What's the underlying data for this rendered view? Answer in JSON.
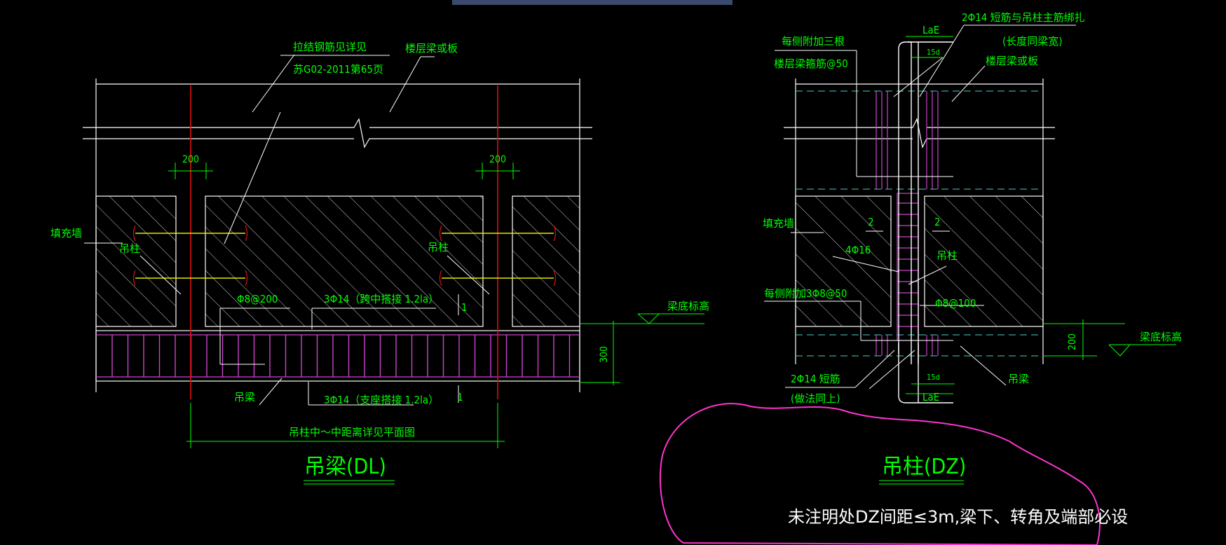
{
  "topbar": {
    "color": "#3a4a6e"
  },
  "colors": {
    "green": "#00ff00",
    "white": "#ffffff",
    "red": "#e01010",
    "magenta": "#cc44cc",
    "yellow": "#e8e800",
    "cyan": "#44cccc",
    "pink": "#ff33cc"
  },
  "left": {
    "note_ref_1": "拉结钢筋见详见",
    "note_ref_2": "苏G02-2011第65页",
    "slab_label": "楼层梁或板",
    "dim_200_a": "200",
    "dim_200_b": "200",
    "infill_label": "填充墙",
    "col_label_a": "吊柱",
    "col_label_b": "吊柱",
    "stirrup_label": "Φ8@200",
    "top_bar_label": "3Φ14（跨中搭接 1.2la）",
    "bot_bar_label": "3Φ14（支座搭接 1.2la）",
    "section_mark_1": "1",
    "section_mark_2": "1",
    "beam_bottom_label": "梁底标高",
    "dim_300": "300",
    "beam_label": "吊梁",
    "span_label": "吊柱中～中距离详见平面图",
    "title": "吊梁(DL)"
  },
  "right": {
    "lae_top": "LaE",
    "d15_top": "15d",
    "note_each_side_1": "每侧附加三根",
    "note_each_side_2": "楼层梁箍筋@50",
    "note_short_bar_1": "2Φ14 短筋与吊柱主筋绑扎",
    "note_short_bar_2": "(长度同梁宽)",
    "slab_label": "楼层梁或板",
    "infill_label": "填充墙",
    "num_2a": "2",
    "num_2b": "2",
    "main_bar_label": "4Φ16",
    "col_label": "吊柱",
    "stirrup_add_label": "每侧附加3Φ8@50",
    "tie_label": "Φ8@100",
    "beam_bottom_label": "梁底标高",
    "dim_200": "200",
    "short_bar_1": "2Φ14 短筋",
    "short_bar_2": "(做法同上)",
    "d15_bottom": "15d",
    "lae_bottom": "LaE",
    "hang_beam_label": "吊梁",
    "title": "吊柱(DZ)",
    "note": "未注明处DZ间距≤3m,梁下、转角及端部必设"
  }
}
